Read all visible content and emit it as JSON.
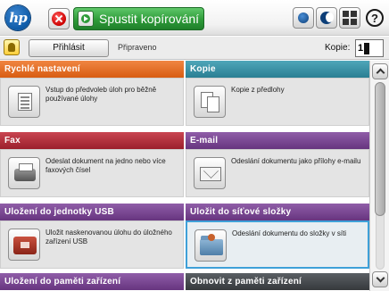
{
  "header": {
    "hp_logo_text": "hp",
    "start_copy_label": "Spustit kopírování",
    "icons": [
      "hp-logo",
      "stop-icon",
      "play-icon",
      "status-icon",
      "sleep-icon",
      "network-icon",
      "help-icon"
    ],
    "help_glyph": "?"
  },
  "subbar": {
    "sign_in_label": "Přihlásit",
    "status_text": "Připraveno",
    "copies_label": "Kopie:",
    "copies_value": "1"
  },
  "sections": {
    "quick_settings": "Rychlé nastavení",
    "copy": "Kopie",
    "fax": "Fax",
    "email": "E-mail",
    "save_usb": "Uložení do jednotky USB",
    "save_network": "Uložit do síťové složky",
    "save_device_memory": "Uložení do paměti zařízení",
    "retrieve_device_memory": "Obnovit z paměti zařízení"
  },
  "tiles": {
    "quick_settings": "Vstup do předvoleb úloh pro běžně používané úlohy",
    "copy": "Kopie z předlohy",
    "fax": "Odeslat dokument na jedno nebo více faxových čísel",
    "email": "Odeslání dokumentu jako přílohy e-mailu",
    "save_usb": "Uložit naskenovanou úlohu do úložného zařízení USB",
    "save_network": "Odeslání dokumentu do složky v síti"
  },
  "colors": {
    "orange": "#e06a1f",
    "teal": "#3a8fa3",
    "red": "#b1303c",
    "purple": "#7a4793",
    "dark": "#45494d",
    "selected_border": "#3ea0d8",
    "start_green": "#2e9b39"
  }
}
